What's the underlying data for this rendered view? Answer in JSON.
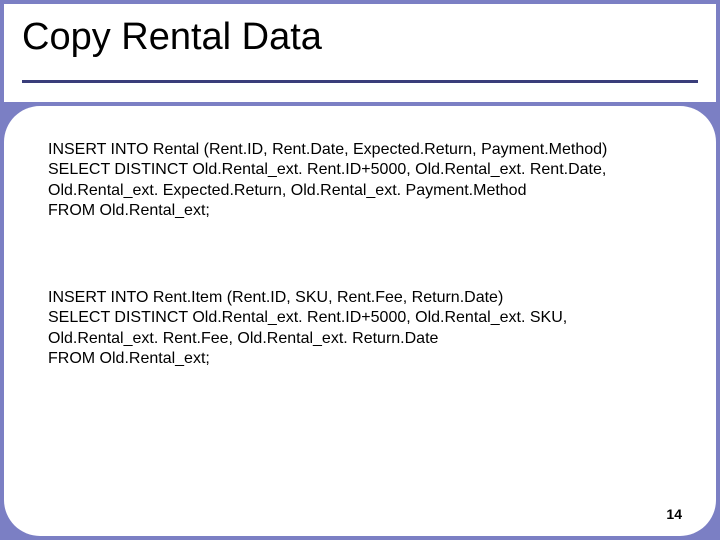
{
  "title": "Copy Rental Data",
  "sql1": {
    "l1": "INSERT INTO Rental (Rent.ID, Rent.Date, Expected.Return, Payment.Method)",
    "l2": "SELECT DISTINCT Old.Rental_ext. Rent.ID+5000, Old.Rental_ext. Rent.Date,",
    "l3": "Old.Rental_ext. Expected.Return, Old.Rental_ext. Payment.Method",
    "l4": "FROM Old.Rental_ext;"
  },
  "sql2": {
    "l1": "INSERT INTO Rent.Item (Rent.ID, SKU, Rent.Fee, Return.Date)",
    "l2": "SELECT DISTINCT Old.Rental_ext. Rent.ID+5000, Old.Rental_ext. SKU,",
    "l3": "Old.Rental_ext. Rent.Fee, Old.Rental_ext. Return.Date",
    "l4": "FROM Old.Rental_ext;"
  },
  "page_number": "14"
}
